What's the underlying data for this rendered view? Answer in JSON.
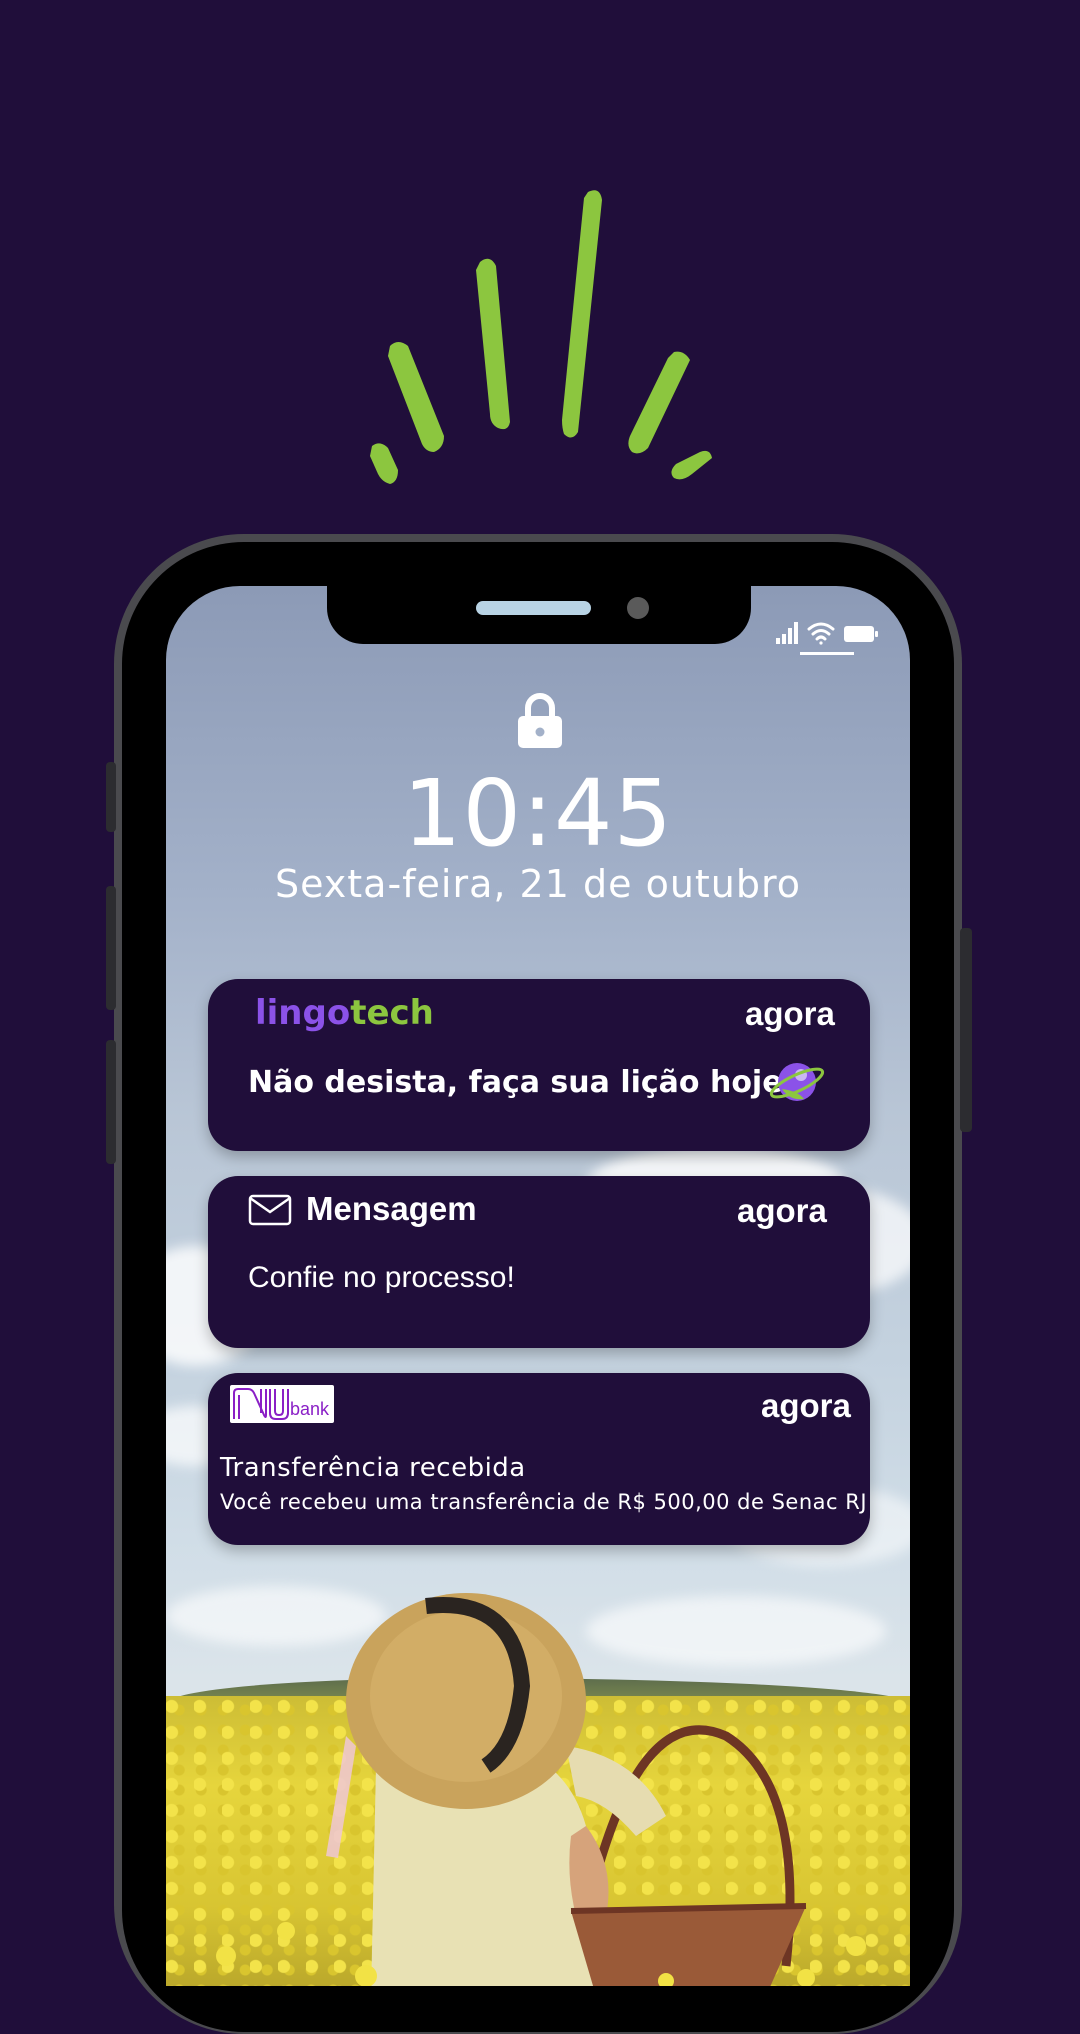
{
  "colors": {
    "background": "#200e3a",
    "accent_green": "#8cc63f",
    "accent_purple": "#8b52e8",
    "card": "#200e3a"
  },
  "decoration": {
    "icon": "sparkle-burst-icon"
  },
  "lock_screen": {
    "time": "10:45",
    "date": "Sexta-feira, 21 de outubro",
    "lock_icon": "lock-icon"
  },
  "status_bar": {
    "icons": [
      "signal-icon",
      "wifi-icon",
      "battery-icon"
    ]
  },
  "notifications": [
    {
      "app": "lingotech",
      "brand_part1": "lingo",
      "brand_part2": "tech",
      "time": "agora",
      "body": "Não desista, faça sua lição hoje",
      "icon": "planet-icon"
    },
    {
      "app": "Mensagem",
      "title": "Mensagem",
      "time": "agora",
      "body": "Confie no processo!",
      "icon": "envelope-icon"
    },
    {
      "app": "nubank",
      "logo_text": "bank",
      "time": "agora",
      "title": "Transferência recebida",
      "body": "Você recebeu uma transferência de R$ 500,00 de Senac RJ"
    }
  ]
}
